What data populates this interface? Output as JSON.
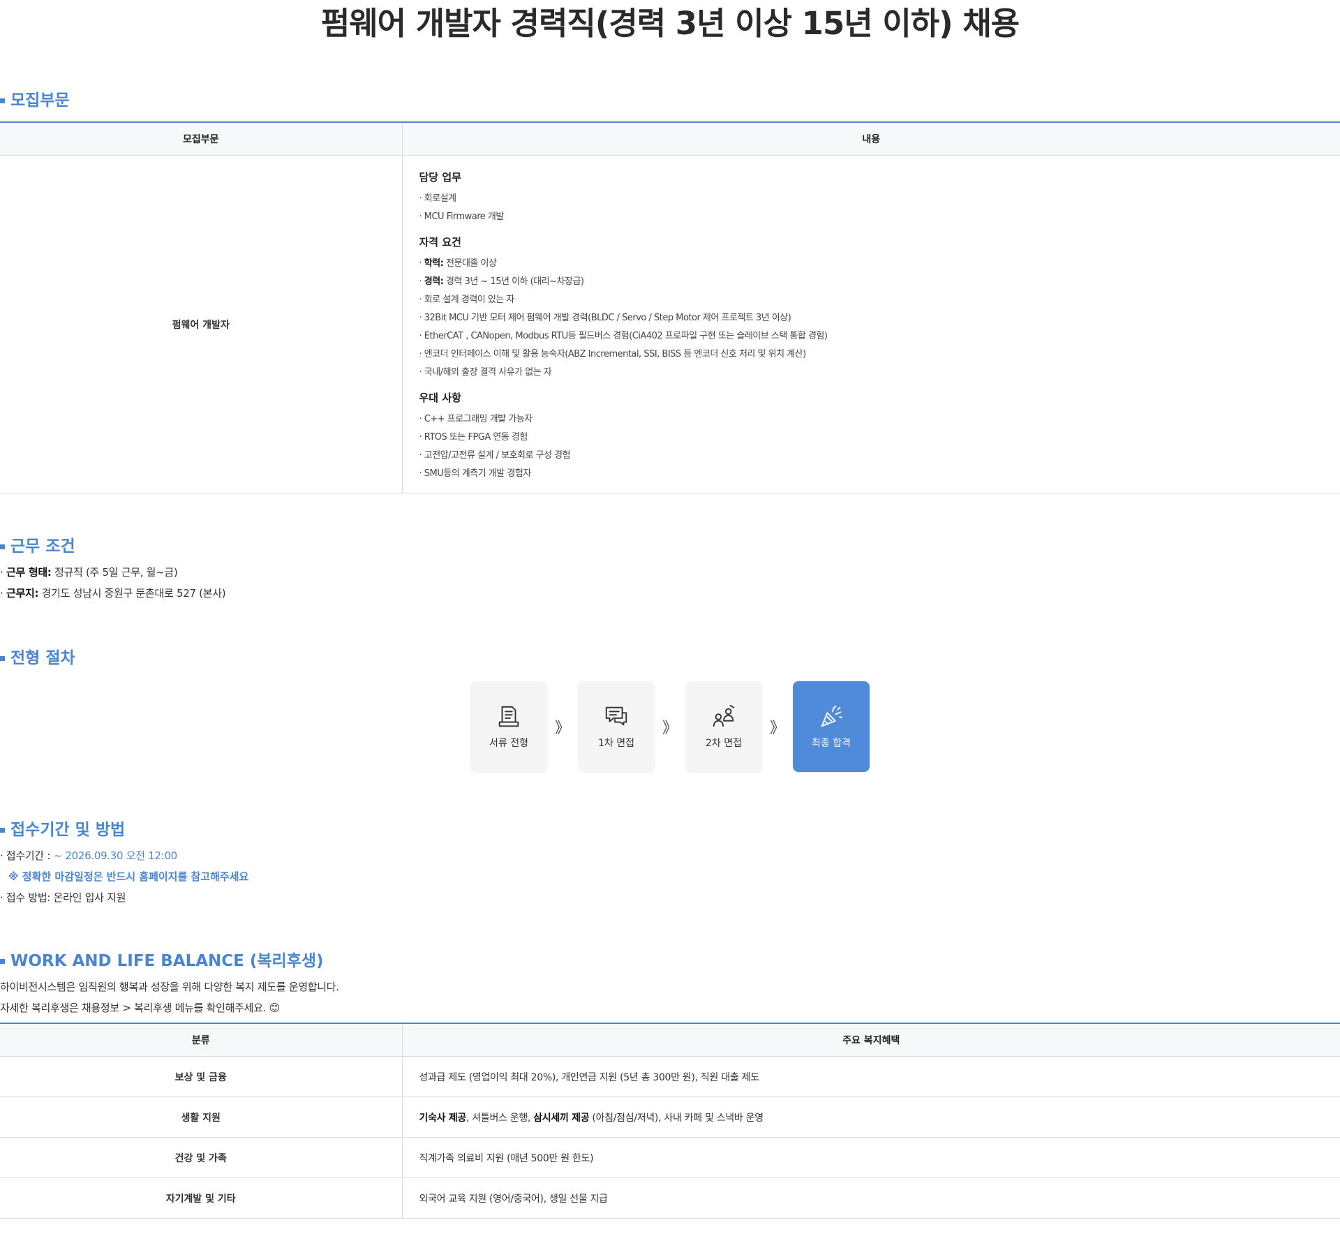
{
  "page_title": "펌웨어 개발자 경력직(경력 3년 이상 15년 이하) 채용",
  "recruit": {
    "heading": "모집부문",
    "col_field": "모집부문",
    "col_content": "내용",
    "field_name": "펌웨어 개발자",
    "duties_title": "담당 업무",
    "duties": [
      "· 회로설계",
      "· MCU Firmware 개발"
    ],
    "req_title": "자격 요건",
    "req_edu_label": "학력:",
    "req_edu_value": " 전문대졸 이상",
    "req_exp_label": "경력:",
    "req_exp_value": " 경력 3년 ~ 15년 이하 (대리~차장급)",
    "req_items": [
      "· 회로 설계 경력이 있는 자",
      "· 32Bit MCU 기반 모터 제어 펌웨어 개발 경력(BLDC / Servo / Step Motor 제어 프로젝트 3년 이상)",
      "· EtherCAT , CANopen, Modbus RTU등 필드버스 경험(CiA402 프로파일 구현 또는 슬레이브 스택 통합 경험)",
      "· 엔코더 인터페이스 이해 및 활용 능숙자(ABZ Incremental, SSI, BISS 등 엔코더 신호 처리 및 위치 계산)",
      "· 국내/해외 출장 결격 사유가 없는 자"
    ],
    "pref_title": "우대 사항",
    "pref_items": [
      "· C++ 프로그래밍 개발 가능자",
      "· RTOS 또는 FPGA 연동 경험",
      "· 고전압/고전류 설계 / 보호회로 구성 경험",
      "· SMU등의 계측기 개발 경험자"
    ]
  },
  "work": {
    "heading": "근무 조건",
    "type_label": "근무 형태:",
    "type_value": " 정규직 (주 5일 근무, 월~금)",
    "place_label": "근무지:",
    "place_value": " 경기도 성남시 중원구 둔촌대로 527 (본사)"
  },
  "process": {
    "heading": "전형 절차",
    "arrow": "》",
    "steps": [
      {
        "label": "서류 전형",
        "icon": "document-icon"
      },
      {
        "label": "1차 면접",
        "icon": "chat-icon"
      },
      {
        "label": "2차 면접",
        "icon": "interview-icon"
      },
      {
        "label": "최종 합격",
        "icon": "celebration-icon"
      }
    ]
  },
  "apply": {
    "heading": "접수기간 및 방법",
    "period_label": "· 접수기간 : ",
    "period_value": "~ 2026.09.30 오전 12:00",
    "note": "※ 정확한 마감일정은 반드시 홈페이지를 참고해주세요",
    "method": "· 접수 방법: 온라인 입사 지원"
  },
  "welfare": {
    "heading": "WORK AND LIFE BALANCE (복리후생)",
    "intro1": "하이비전시스템은 임직원의 행복과 성장을 위해 다양한 복지 제도를 운영합니다.",
    "intro2": "자세한 복리후생은 채용정보 > 복리후생 메뉴를 확인해주세요. 😊",
    "col_cat": "분류",
    "col_benefit": "주요 복지혜택",
    "rows": [
      {
        "cat": "보상 및 금융",
        "b1": "",
        "t1": "성과급 제도 (영업이익 최대 20%), 개인연금 지원 (5년 총 300만 원), 직원 대출 제도",
        "b2": "",
        "t2": ""
      },
      {
        "cat": "생활 지원",
        "b1": "기숙사 제공",
        "t1": ", 셔틀버스 운행, ",
        "b2": "삼시세끼 제공",
        "t2": " (아침/점심/저녁), 사내 카페 및 스낵바 운영"
      },
      {
        "cat": "건강 및 가족",
        "b1": "",
        "t1": "직계가족 의료비 지원 (매년 500만 원 한도)",
        "b2": "",
        "t2": ""
      },
      {
        "cat": "자기계발 및 기타",
        "b1": "",
        "t1": "외국어 교육 지원 (영어/중국어), 생일 선물 지급",
        "b2": "",
        "t2": ""
      }
    ]
  },
  "colors": {
    "accent": "#4a86d0",
    "active_step": "#4f8bd8"
  }
}
